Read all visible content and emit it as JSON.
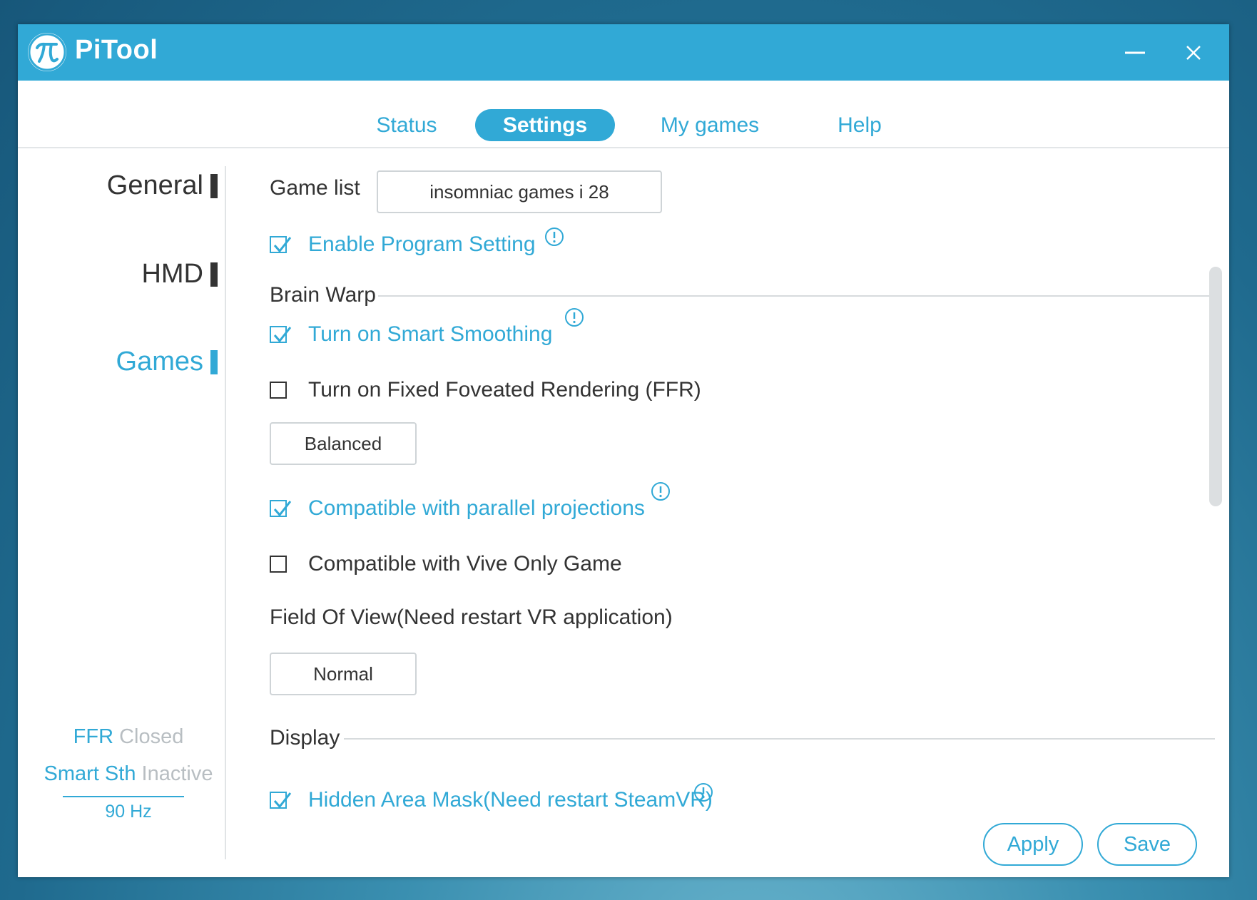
{
  "app": {
    "title": "PiTool"
  },
  "tabs": [
    {
      "label": "Status",
      "active": false
    },
    {
      "label": "Settings",
      "active": true
    },
    {
      "label": "My games",
      "active": false
    },
    {
      "label": "Help",
      "active": false
    }
  ],
  "sidebar": {
    "items": [
      {
        "label": "General",
        "active": false
      },
      {
        "label": "HMD",
        "active": false
      },
      {
        "label": "Games",
        "active": true
      }
    ],
    "status": {
      "ffr_key": "FFR",
      "ffr_value": "Closed",
      "smooth_key": "Smart Sth",
      "smooth_value": "Inactive",
      "refresh": "90 Hz"
    }
  },
  "games": {
    "game_list_label": "Game list",
    "game_list_value": "insomniac games i 28",
    "enable_program_setting": {
      "label": "Enable Program Setting",
      "checked": true
    },
    "brain_warp_title": "Brain Warp",
    "smart_smoothing": {
      "label": "Turn on Smart Smoothing",
      "checked": true
    },
    "ffr": {
      "label": "Turn on Fixed Foveated Rendering (FFR)",
      "checked": false
    },
    "ffr_level": "Balanced",
    "parallel_projections": {
      "label": "Compatible with parallel projections",
      "checked": true
    },
    "vive_only": {
      "label": "Compatible with Vive Only Game",
      "checked": false
    },
    "fov_label": "Field Of View(Need restart VR application)",
    "fov_value": "Normal",
    "display_title": "Display",
    "hidden_area_mask": {
      "label": "Hidden Area Mask(Need restart SteamVR)",
      "checked": true
    }
  },
  "actions": {
    "apply": "Apply",
    "save": "Save"
  },
  "colors": {
    "accent": "#31a9d6",
    "text": "#333333",
    "muted": "#b8bec2"
  }
}
